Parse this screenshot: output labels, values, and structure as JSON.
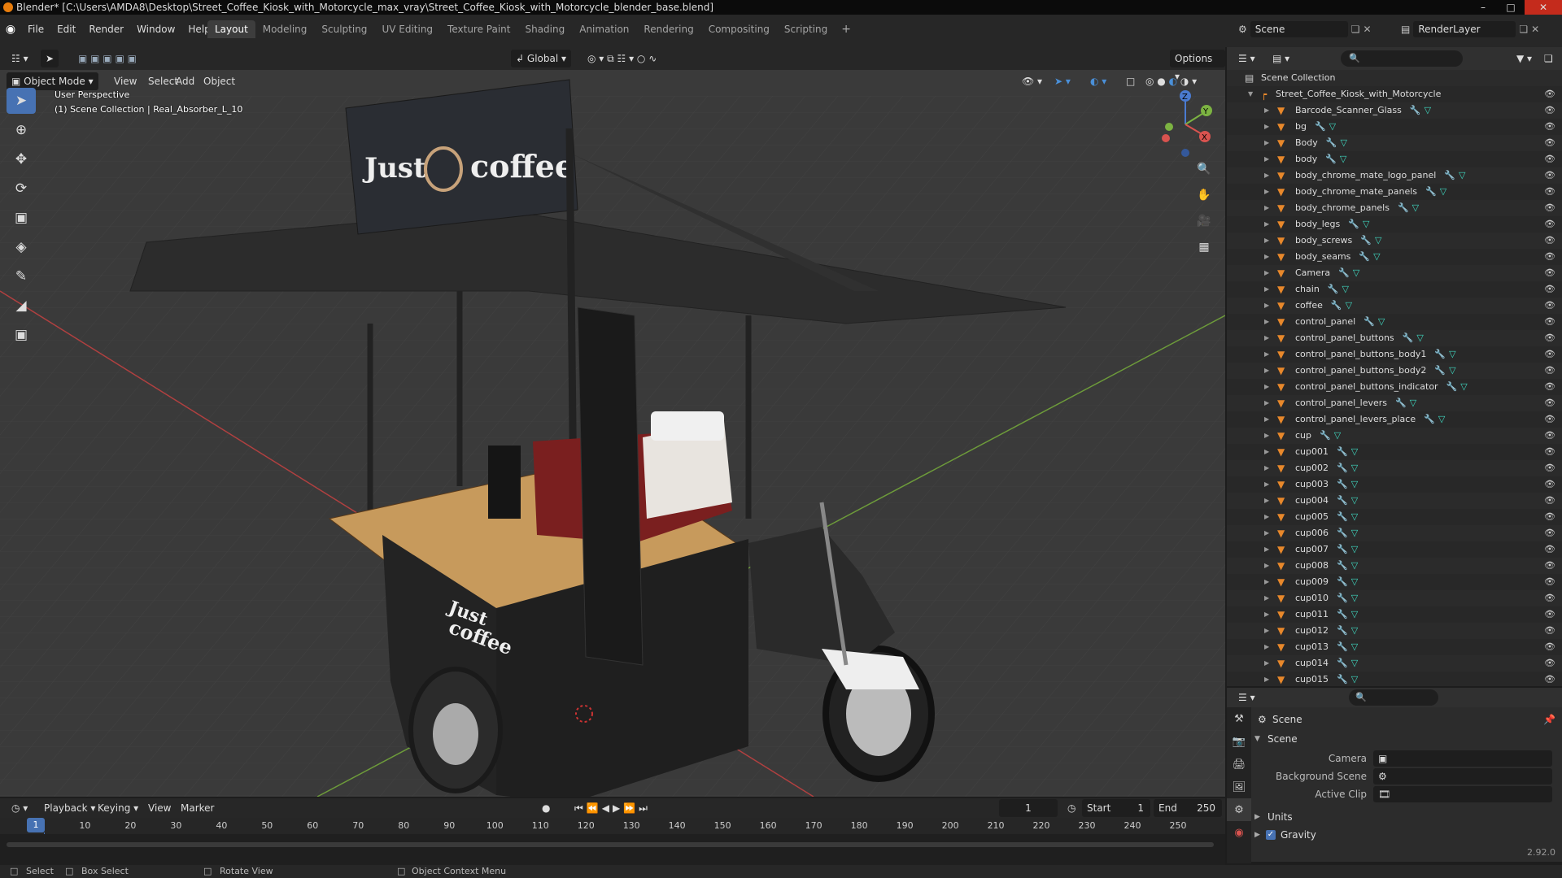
{
  "window": {
    "title": "Blender* [C:\\Users\\AMDA8\\Desktop\\Street_Coffee_Kiosk_with_Motorcycle_max_vray\\Street_Coffee_Kiosk_with_Motorcycle_blender_base.blend]"
  },
  "menu": [
    "File",
    "Edit",
    "Render",
    "Window",
    "Help"
  ],
  "workspaces": [
    "Layout",
    "Modeling",
    "Sculpting",
    "UV Editing",
    "Texture Paint",
    "Shading",
    "Animation",
    "Rendering",
    "Compositing",
    "Scripting"
  ],
  "active_workspace": "Layout",
  "scene_selector": "Scene",
  "renderlayer_selector": "RenderLayer",
  "viewport_header": {
    "mode": "Object Mode",
    "menus": [
      "View",
      "Select",
      "Add",
      "Object"
    ],
    "orientation": "Global",
    "options": "Options"
  },
  "viewport": {
    "perspective_label": "User Perspective",
    "collection_label": "(1) Scene Collection | Real_Absorber_L_10",
    "sign_left": "Just",
    "sign_right": "coffee",
    "cart_text_1": "Just",
    "cart_text_2": "coffee"
  },
  "outliner": {
    "root": "Scene Collection",
    "collection": "Street_Coffee_Kiosk_with_Motorcycle",
    "items": [
      "Barcode_Scanner_Glass",
      "bg",
      "Body",
      "body",
      "body_chrome_mate_logo_panel",
      "body_chrome_mate_panels",
      "body_chrome_panels",
      "body_legs",
      "body_screws",
      "body_seams",
      "Camera",
      "chain",
      "coffee",
      "control_panel",
      "control_panel_buttons",
      "control_panel_buttons_body1",
      "control_panel_buttons_body2",
      "control_panel_buttons_indicator",
      "control_panel_levers",
      "control_panel_levers_place",
      "cup",
      "cup001",
      "cup002",
      "cup003",
      "cup004",
      "cup005",
      "cup006",
      "cup007",
      "cup008",
      "cup009",
      "cup010",
      "cup011",
      "cup012",
      "cup013",
      "cup014",
      "cup015"
    ]
  },
  "properties": {
    "context": "Scene",
    "panel": "Scene",
    "camera_label": "Camera",
    "background_label": "Background Scene",
    "clip_label": "Active Clip",
    "units_label": "Units",
    "gravity_label": "Gravity",
    "version": "2.92.0"
  },
  "timeline": {
    "menus": [
      "Playback",
      "Keying",
      "View",
      "Marker"
    ],
    "current_frame": "1",
    "start_label": "Start",
    "start": "1",
    "end_label": "End",
    "end": "250",
    "ticks": [
      "1",
      "10",
      "20",
      "30",
      "40",
      "50",
      "60",
      "70",
      "80",
      "90",
      "100",
      "110",
      "120",
      "130",
      "140",
      "150",
      "160",
      "170",
      "180",
      "190",
      "200",
      "210",
      "220",
      "230",
      "240",
      "250"
    ]
  },
  "statusbar": {
    "select": "Select",
    "box_select": "Box Select",
    "rotate": "Rotate View",
    "context_menu": "Object Context Menu"
  }
}
